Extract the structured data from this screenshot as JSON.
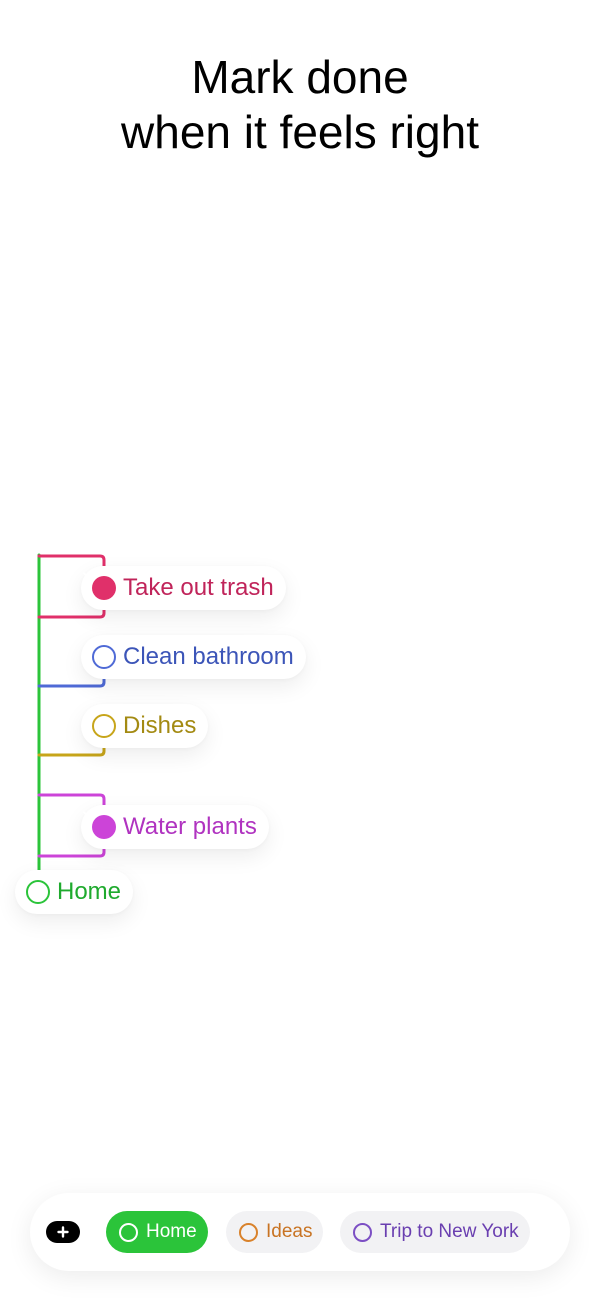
{
  "headline": {
    "line1": "Mark done",
    "line2": "when it feels right"
  },
  "tree": {
    "parent": {
      "label": "Home",
      "color": "#2bc43a",
      "done": false
    },
    "children": [
      {
        "label": "Take out trash",
        "color": "#e0306a",
        "done": true
      },
      {
        "label": "Clean bathroom",
        "color": "#4f6ad6",
        "done": false
      },
      {
        "label": "Dishes",
        "color": "#c7a51a",
        "done": false
      },
      {
        "label": "Water plants",
        "color": "#cc44d8",
        "done": true
      }
    ]
  },
  "tabbar": {
    "add_icon": "plus-icon",
    "tabs": [
      {
        "label": "Home",
        "color": "#2bc43a",
        "active": true
      },
      {
        "label": "Ideas",
        "color": "#d9822b",
        "active": false
      },
      {
        "label": "Trip to New York",
        "color": "#7c4fc4",
        "active": false
      }
    ]
  },
  "colors": {
    "trash_text": "#c0245a",
    "bathroom_text": "#3c55b8",
    "dishes_text": "#a38a12",
    "plants_text": "#b033c0",
    "home_text": "#1faa2e",
    "ideas_text": "#c87322",
    "trip_text": "#6a3fb0",
    "inactive_tab_bg": "#f2f2f4"
  }
}
